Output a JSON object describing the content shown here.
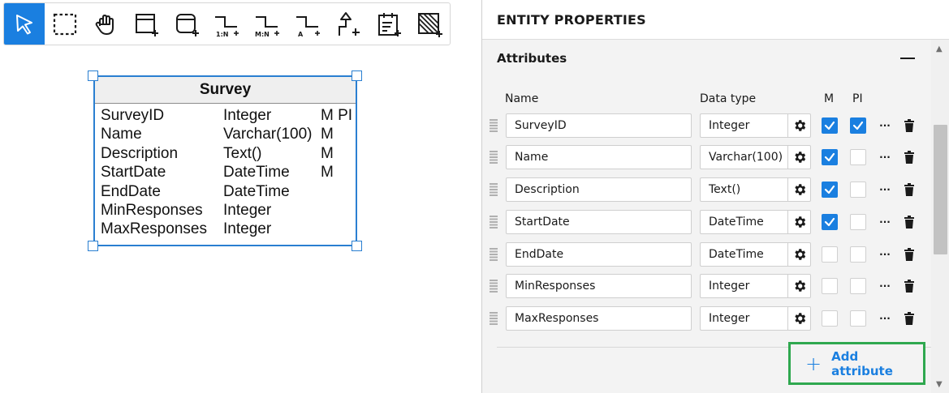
{
  "toolbar": {
    "tools": [
      {
        "icon": "pointer-icon",
        "label": ""
      },
      {
        "icon": "selection-rectangle-icon",
        "label": ""
      },
      {
        "icon": "hand-pan-icon",
        "label": ""
      },
      {
        "icon": "add-entity-icon",
        "label": ""
      },
      {
        "icon": "add-rounded-entity-icon",
        "label": ""
      },
      {
        "icon": "relation-one-to-many-icon",
        "label": "1:N"
      },
      {
        "icon": "relation-many-to-many-icon",
        "label": "M:N"
      },
      {
        "icon": "relation-attribute-icon",
        "label": "A"
      },
      {
        "icon": "inheritance-icon",
        "label": ""
      },
      {
        "icon": "add-note-icon",
        "label": ""
      },
      {
        "icon": "add-hatched-area-icon",
        "label": ""
      }
    ],
    "accent": "#1a7fe0"
  },
  "entity": {
    "title": "Survey",
    "border_color": "#2a7fd1",
    "rows": [
      {
        "name": "SurveyID",
        "type": "Integer",
        "flags": "M PI"
      },
      {
        "name": "Name",
        "type": "Varchar(100)",
        "flags": "M"
      },
      {
        "name": "Description",
        "type": "Text()",
        "flags": "M"
      },
      {
        "name": "StartDate",
        "type": "DateTime",
        "flags": "M"
      },
      {
        "name": "EndDate",
        "type": "DateTime",
        "flags": ""
      },
      {
        "name": "MinResponses",
        "type": "Integer",
        "flags": ""
      },
      {
        "name": "MaxResponses",
        "type": "Integer",
        "flags": ""
      }
    ]
  },
  "panel": {
    "title": "ENTITY PROPERTIES",
    "section": "Attributes",
    "columns": {
      "name": "Name",
      "type": "Data type",
      "m": "M",
      "pi": "PI"
    },
    "more_label": "···",
    "attributes": [
      {
        "name": "SurveyID",
        "type": "Integer",
        "m": true,
        "pi": true
      },
      {
        "name": "Name",
        "type": "Varchar(100)",
        "m": true,
        "pi": false
      },
      {
        "name": "Description",
        "type": "Text()",
        "m": true,
        "pi": false
      },
      {
        "name": "StartDate",
        "type": "DateTime",
        "m": true,
        "pi": false
      },
      {
        "name": "EndDate",
        "type": "DateTime",
        "m": false,
        "pi": false
      },
      {
        "name": "MinResponses",
        "type": "Integer",
        "m": false,
        "pi": false
      },
      {
        "name": "MaxResponses",
        "type": "Integer",
        "m": false,
        "pi": false
      }
    ],
    "add_plus": "+",
    "add_label": "Add attribute",
    "highlight_color": "#2fa84f"
  }
}
